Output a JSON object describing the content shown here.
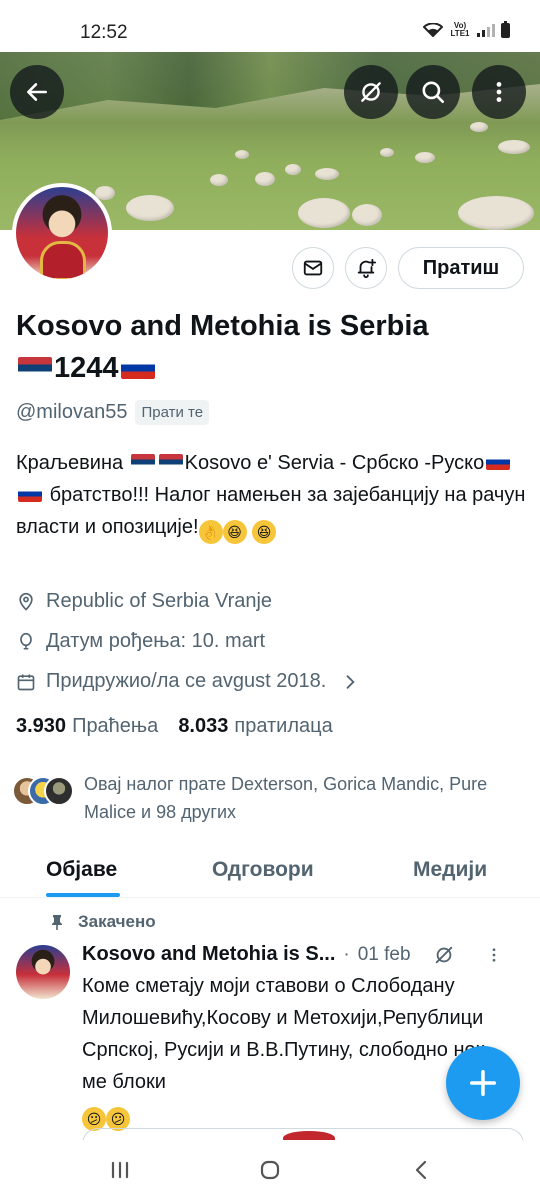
{
  "status_bar": {
    "time": "12:52",
    "network_label": "Vo) LTE1"
  },
  "banner": {
    "back_icon": "arrow-left-icon",
    "actions": [
      "no-grok-icon",
      "search-icon",
      "more-vertical-icon"
    ]
  },
  "profile": {
    "display_name": "Kosovo and Metohia is Serbia",
    "name_suffix": "1244",
    "handle": "@milovan55",
    "follows_you": "Прати те",
    "bio_part1": "Краљевина",
    "bio_part2": "Kosovo e' Servia - Србско -Руско",
    "bio_part3": "братство!!! Налог намењен за зајебанцију на рачун власти и опозиције!",
    "location": "Republic of Serbia Vranje",
    "birthday": "Датум рођења: 10. mart",
    "joined": "Придружио/ла се avgust 2018.",
    "following_count": "3.930",
    "following_label": "Праћења",
    "followers_count": "8.033",
    "followers_label": "пратилаца",
    "followed_by": "Овај налог прате Dexterson, Gorica Mandic, Pure Malice и 98 других"
  },
  "actions": {
    "message_icon": "envelope-icon",
    "notify_icon": "bell-plus-icon",
    "follow_label": "Пратиш"
  },
  "tabs": [
    {
      "label": "Објаве",
      "active": true
    },
    {
      "label": "Одговори",
      "active": false
    },
    {
      "label": "Медији",
      "active": false
    }
  ],
  "pinned_post": {
    "pinned_label": "Закачено",
    "author": "Kosovo and Metohia is S...",
    "separator": "·",
    "date": "01 feb",
    "text": "Коме сметају моји ставови о Слободану Милошевићу,Косову и Метохији,Републици Српској, Русији и В.В.Путину, слободно нек ме блоки"
  },
  "colors": {
    "accent": "#1d9bf0",
    "text_primary": "#0f1419",
    "text_secondary": "#536471",
    "border": "#cfd9de"
  }
}
